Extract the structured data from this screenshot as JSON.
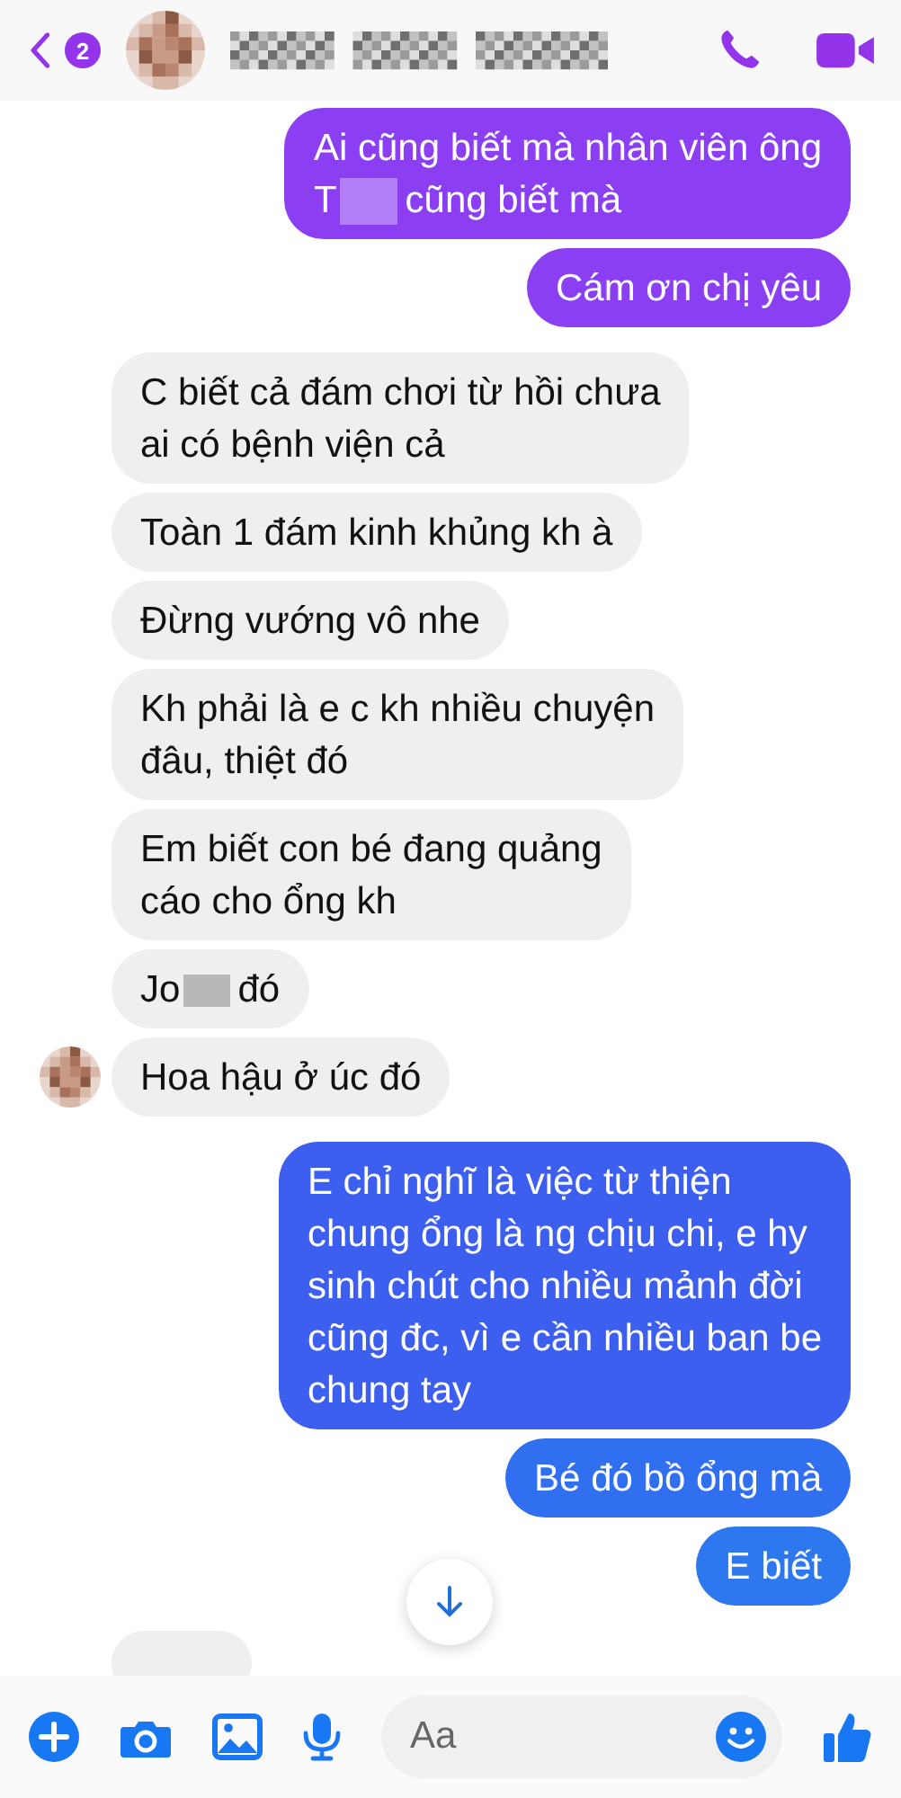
{
  "header": {
    "unread_count": "2"
  },
  "messages": [
    {
      "kind": "sent",
      "color": "#8c3ff2",
      "show_avatar": false,
      "cut_off": false,
      "lines": [
        [
          {
            "kind": "text",
            "text": "Ai cũng biết mà nhân viên ông"
          }
        ],
        [
          {
            "kind": "text",
            "text": "T"
          },
          {
            "kind": "redaction"
          },
          {
            "kind": "text",
            "text": "cũng biết mà"
          }
        ]
      ]
    },
    {
      "kind": "sent",
      "color": "#8a3ff2",
      "show_avatar": false,
      "cut_off": false,
      "lines": [
        [
          {
            "kind": "text",
            "text": "Cám ơn chị yêu"
          }
        ]
      ]
    },
    {
      "kind": "received",
      "show_avatar": false,
      "cut_off": false,
      "lines": [
        [
          {
            "kind": "text",
            "text": "C biết cả đám chơi từ hồi chưa"
          }
        ],
        [
          {
            "kind": "text",
            "text": "ai có bệnh viện cả"
          }
        ]
      ]
    },
    {
      "kind": "received",
      "show_avatar": false,
      "cut_off": false,
      "lines": [
        [
          {
            "kind": "text",
            "text": "Toàn 1 đám kinh khủng kh à"
          }
        ]
      ]
    },
    {
      "kind": "received",
      "show_avatar": false,
      "cut_off": false,
      "lines": [
        [
          {
            "kind": "text",
            "text": "Đừng vướng vô nhe"
          }
        ]
      ]
    },
    {
      "kind": "received",
      "show_avatar": false,
      "cut_off": false,
      "lines": [
        [
          {
            "kind": "text",
            "text": "Kh phải là e c kh nhiều chuyện"
          }
        ],
        [
          {
            "kind": "text",
            "text": "đâu, thiệt đó"
          }
        ]
      ]
    },
    {
      "kind": "received",
      "show_avatar": false,
      "cut_off": false,
      "lines": [
        [
          {
            "kind": "text",
            "text": "Em biết con bé đang quảng"
          }
        ],
        [
          {
            "kind": "text",
            "text": "cáo cho ổng kh"
          }
        ]
      ]
    },
    {
      "kind": "received",
      "show_avatar": false,
      "cut_off": false,
      "lines": [
        [
          {
            "kind": "text",
            "text": "Jo"
          },
          {
            "kind": "redaction"
          },
          {
            "kind": "text",
            "text": "đó"
          }
        ]
      ]
    },
    {
      "kind": "received",
      "show_avatar": true,
      "cut_off": false,
      "lines": [
        [
          {
            "kind": "text",
            "text": "Hoa hậu ở úc đó"
          }
        ]
      ]
    },
    {
      "kind": "sent",
      "color": "#3c5ff0",
      "show_avatar": false,
      "cut_off": false,
      "lines": [
        [
          {
            "kind": "text",
            "text": "E chỉ nghĩ là việc từ thiện"
          }
        ],
        [
          {
            "kind": "text",
            "text": "chung ổng là ng chịu chi, e hy"
          }
        ],
        [
          {
            "kind": "text",
            "text": "sinh chút cho nhiều mảnh đời"
          }
        ],
        [
          {
            "kind": "text",
            "text": "cũng đc, vì e cần nhiều ban be"
          }
        ],
        [
          {
            "kind": "text",
            "text": "chung tay"
          }
        ]
      ]
    },
    {
      "kind": "sent",
      "color": "#2f6ff0",
      "show_avatar": false,
      "cut_off": false,
      "lines": [
        [
          {
            "kind": "text",
            "text": "Bé đó bồ ổng mà"
          }
        ]
      ]
    },
    {
      "kind": "sent",
      "color": "#2d78ee",
      "show_avatar": false,
      "cut_off": false,
      "lines": [
        [
          {
            "kind": "text",
            "text": "E biết"
          }
        ]
      ]
    },
    {
      "kind": "received",
      "show_avatar": false,
      "cut_off": true
    }
  ],
  "composer": {
    "placeholder": "Aa"
  }
}
